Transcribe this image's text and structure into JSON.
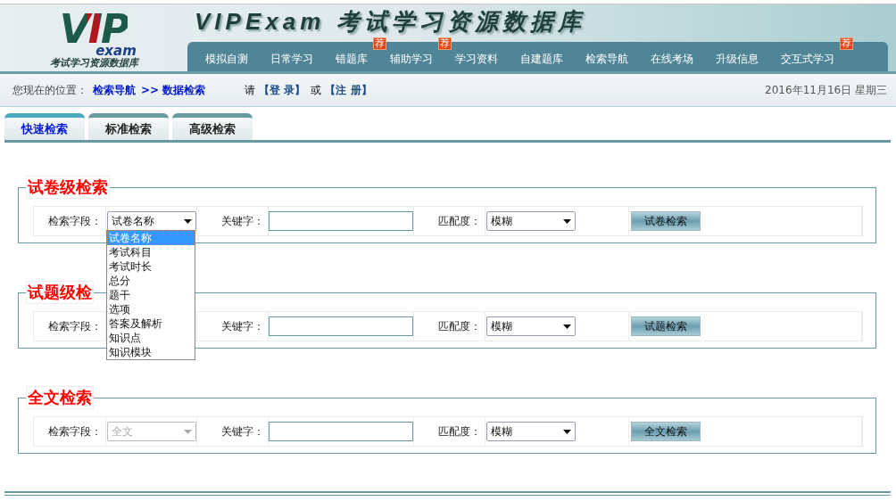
{
  "header": {
    "logo": {
      "mark": "VIP",
      "sub": "exam",
      "caption": "考试学习资源数据库"
    },
    "title": "VIPExam 考试学习资源数据库"
  },
  "nav": [
    {
      "label": "模拟自测"
    },
    {
      "label": "日常学习"
    },
    {
      "label": "错题库",
      "badge": "荐"
    },
    {
      "label": "辅助学习",
      "badge": "荐"
    },
    {
      "label": "学习资料"
    },
    {
      "label": "自建题库"
    },
    {
      "label": "检索导航"
    },
    {
      "label": "在线考场"
    },
    {
      "label": "升级信息"
    },
    {
      "label": "交互式学习",
      "badge": "荐"
    }
  ],
  "breadcrumb": {
    "prefix": "您现在的位置：",
    "links": [
      "检索导航",
      ">> 数据检索"
    ],
    "login_prompt": "请",
    "login": "【登 录】",
    "or": "或",
    "register": "【注 册】",
    "date": "2016年11月16日 星期三"
  },
  "tabs": [
    {
      "label": "快速检索",
      "selected": true
    },
    {
      "label": "标准检索",
      "selected": false
    },
    {
      "label": "高级检索",
      "selected": false
    }
  ],
  "sections": [
    {
      "title": "试卷级检索",
      "field_label": "检索字段：",
      "field_select": {
        "value": "试卷名称",
        "disabled": false
      },
      "dropdown": [
        {
          "label": "试卷名称",
          "selected": true
        },
        {
          "label": "考试科目",
          "selected": false
        },
        {
          "label": "考试时长",
          "selected": false
        },
        {
          "label": "总分",
          "selected": false
        },
        {
          "label": "题干",
          "selected": false
        },
        {
          "label": "选项",
          "selected": false
        },
        {
          "label": "答案及解析",
          "selected": false
        },
        {
          "label": "知识点",
          "selected": false
        },
        {
          "label": "知识模块",
          "selected": false
        }
      ],
      "keyword_label": "关键字：",
      "match_label": "匹配度：",
      "match_value": "模糊",
      "button": "试卷检索"
    },
    {
      "title": "试题级检",
      "field_label": "检索字段：",
      "keyword_label": "关键字：",
      "match_label": "匹配度：",
      "match_value": "模糊",
      "button": "试题检索"
    },
    {
      "title": "全文检索",
      "field_label": "检索字段：",
      "field_select": {
        "value": "全文",
        "disabled": true
      },
      "keyword_label": "关键字：",
      "match_label": "匹配度：",
      "match_value": "模糊",
      "button": "全文检索"
    }
  ]
}
